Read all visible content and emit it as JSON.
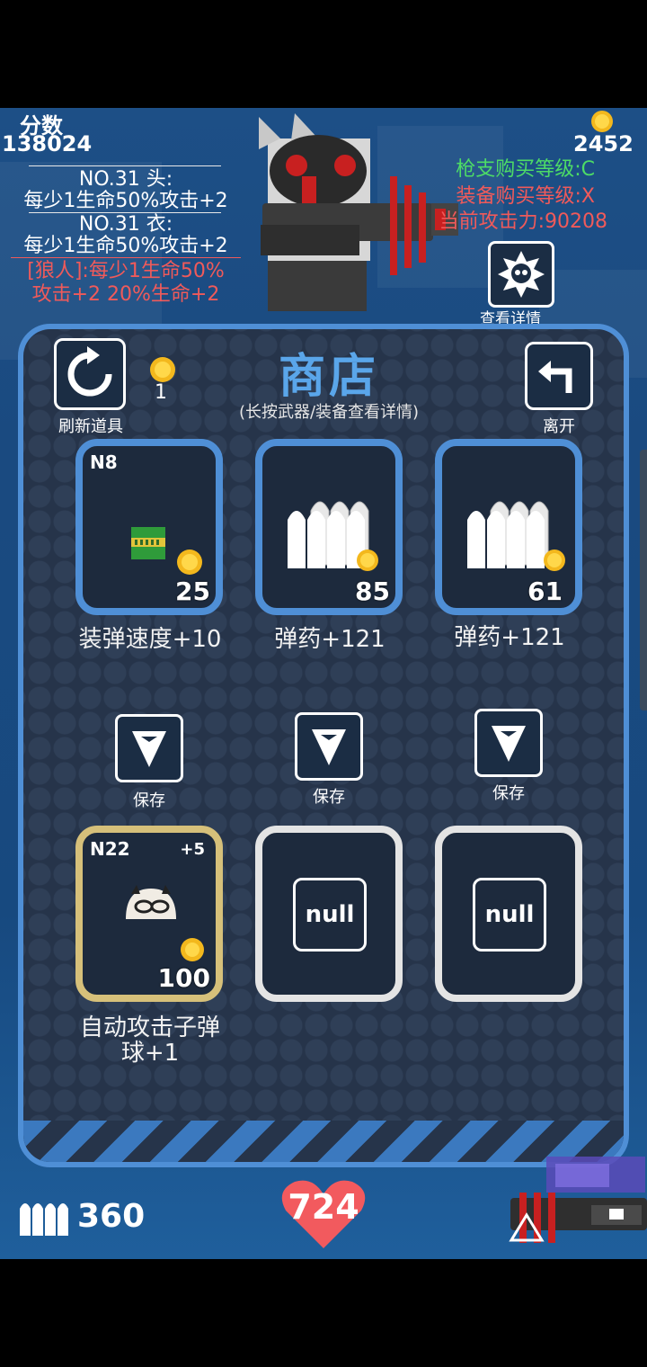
{
  "hud": {
    "score_label": "分数",
    "score_value": "138024",
    "perks": [
      "NO.31 头:",
      "每少1生命50%攻击+2",
      "NO.31 衣:",
      "每少1生命50%攻击+2"
    ],
    "set_bonus_line1": "[狼人]:每少1生命50%",
    "set_bonus_line2": "攻击+2 20%生命+2",
    "coins": "2452",
    "gun_grade": "枪支购买等级:C",
    "equip_grade": "装备购买等级:X",
    "attack_power": "当前攻击力:90208",
    "detail_label": "查看详情"
  },
  "shop": {
    "title": "商店",
    "subtitle": "(长按武器/装备查看详情)",
    "refresh_label": "刷新道具",
    "refresh_cost": "1",
    "leave_label": "离开",
    "top_items": [
      {
        "code": "N8",
        "price": "25",
        "name": "装弹速度+10",
        "icon": "ammo-clip-icon"
      },
      {
        "code": "",
        "price": "85",
        "name": "弹药+121",
        "icon": "bullets-icon"
      },
      {
        "code": "",
        "price": "61",
        "name": "弹药+121",
        "icon": "bullets-icon"
      }
    ],
    "save_label": "保存",
    "bottom_items": [
      {
        "code": "N22",
        "bonus": "+5",
        "price": "100",
        "name_line1": "自动攻击子弹",
        "name_line2": "球+1",
        "icon": "masked-ball-icon"
      },
      {
        "null_text": "null"
      },
      {
        "null_text": "null"
      }
    ]
  },
  "bottom": {
    "ammo": "360",
    "hp": "724"
  },
  "colors": {
    "panel_border": "#4f8fd6",
    "title_blue": "#5aa6ea",
    "green_text": "#4ddc66",
    "red_text": "#f05a5a",
    "gold_border": "#d6c07a",
    "heart": "#f25a5e"
  }
}
